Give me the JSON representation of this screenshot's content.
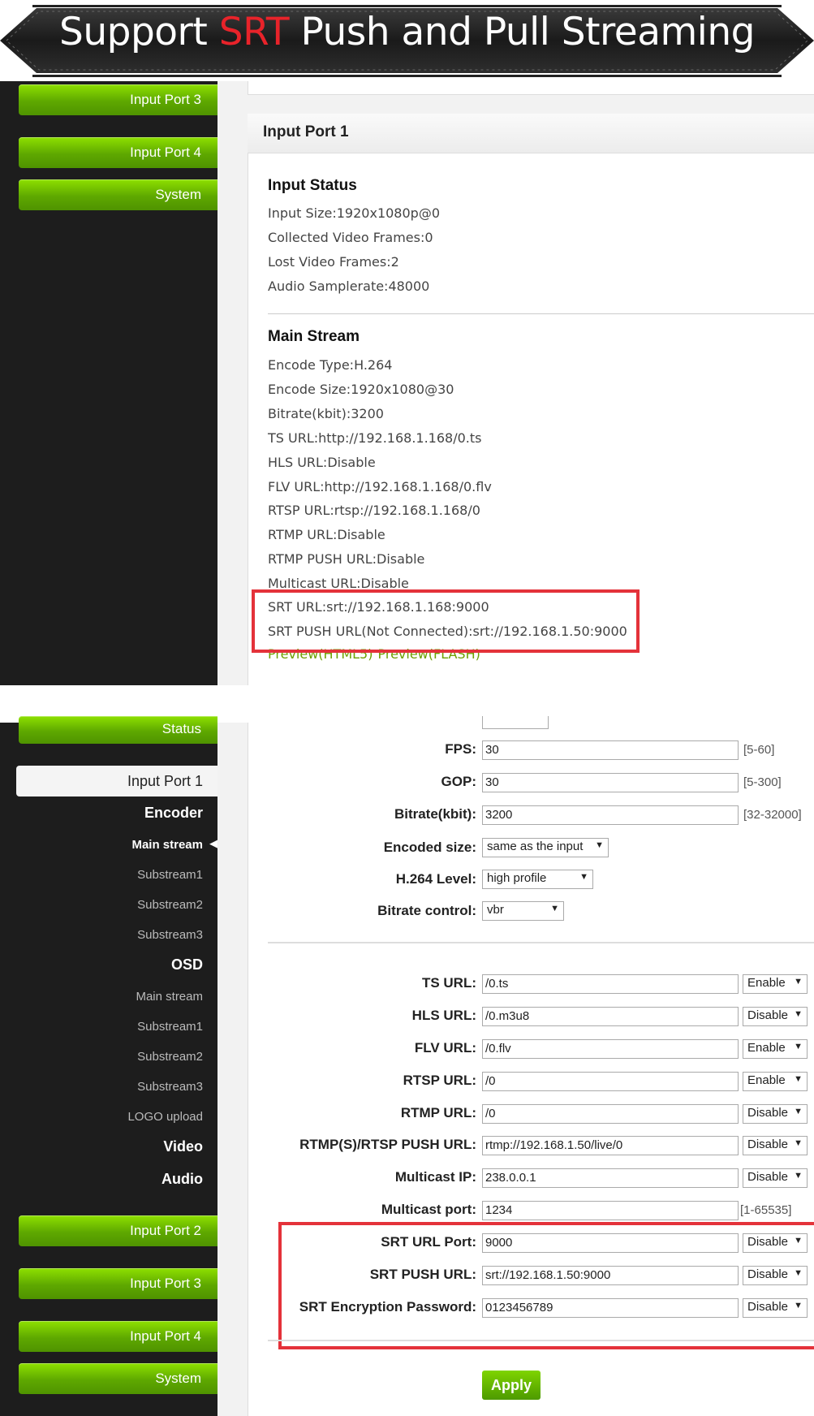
{
  "banner": {
    "title_before": "Support ",
    "title_highlight": "SRT",
    "title_after": " Push and Pull Streaming",
    "highlight_color": "#e8232a"
  },
  "top_sidebar": {
    "items": [
      {
        "label": "Input Port 3"
      },
      {
        "label": "Input Port 4"
      },
      {
        "label": "System"
      }
    ]
  },
  "top_panel": {
    "title": "Input Port 1",
    "input_status": {
      "heading": "Input Status",
      "lines": [
        "Input Size:1920x1080p@0",
        "Collected Video Frames:0",
        "Lost Video Frames:2",
        "Audio Samplerate:48000"
      ]
    },
    "main_stream": {
      "heading": "Main Stream",
      "lines": [
        "Encode Type:H.264",
        "Encode Size:1920x1080@30",
        "Bitrate(kbit):3200",
        "TS URL:http://192.168.1.168/0.ts",
        "HLS URL:Disable",
        "FLV URL:http://192.168.1.168/0.flv",
        "RTSP URL:rtsp://192.168.1.168/0",
        "RTMP URL:Disable",
        "RTMP PUSH URL:Disable",
        "Multicast URL:Disable",
        "SRT URL:srt://192.168.1.168:9000",
        "SRT PUSH URL(Not Connected):srt://192.168.1.50:9000"
      ],
      "preview_html5": "Preview(HTML5)",
      "preview_flash": "Preview(FLASH)"
    }
  },
  "bottom_sidebar": {
    "status_label": "Status",
    "active_item": "Input Port 1",
    "encoder": {
      "label": "Encoder",
      "items": [
        "Main stream",
        "Substream1",
        "Substream2",
        "Substream3"
      ]
    },
    "osd": {
      "label": "OSD",
      "items": [
        "Main stream",
        "Substream1",
        "Substream2",
        "Substream3",
        "LOGO upload"
      ]
    },
    "video_label": "Video",
    "audio_label": "Audio",
    "green_items": [
      {
        "label": "Input Port 2"
      },
      {
        "label": "Input Port 3"
      },
      {
        "label": "Input Port 4"
      },
      {
        "label": "System"
      }
    ]
  },
  "form": {
    "encoding": [
      {
        "label": "FPS:",
        "value": "30",
        "range": "[5-60]"
      },
      {
        "label": "GOP:",
        "value": "30",
        "range": "[5-300]"
      },
      {
        "label": "Bitrate(kbit):",
        "value": "3200",
        "range": "[32-32000]"
      }
    ],
    "selects": [
      {
        "label": "Encoded size:",
        "value": "same as the input"
      },
      {
        "label": "H.264 Level:",
        "value": "high profile"
      },
      {
        "label": "Bitrate control:",
        "value": "vbr"
      }
    ],
    "urls": [
      {
        "label": "TS URL:",
        "value": "/0.ts",
        "state": "Enable"
      },
      {
        "label": "HLS URL:",
        "value": "/0.m3u8",
        "state": "Disable"
      },
      {
        "label": "FLV URL:",
        "value": "/0.flv",
        "state": "Enable"
      },
      {
        "label": "RTSP URL:",
        "value": "/0",
        "state": "Enable"
      },
      {
        "label": "RTMP URL:",
        "value": "/0",
        "state": "Disable"
      },
      {
        "label": "RTMP(S)/RTSP PUSH URL:",
        "value": "rtmp://192.168.1.50/live/0",
        "state": "Disable"
      },
      {
        "label": "Multicast IP:",
        "value": "238.0.0.1",
        "state": "Disable"
      }
    ],
    "multicast_port": {
      "label": "Multicast port:",
      "value": "1234",
      "range": "[1-65535]"
    },
    "srt": [
      {
        "label": "SRT URL Port:",
        "value": "9000",
        "state": "Disable"
      },
      {
        "label": "SRT PUSH URL:",
        "value": "srt://192.168.1.50:9000",
        "state": "Disable"
      },
      {
        "label": "SRT Encryption Password:",
        "value": "0123456789",
        "state": "Disable"
      }
    ],
    "apply_label": "Apply"
  },
  "colors": {
    "sidebar_bg": "#1d1d1d",
    "green_button": "#5ea800",
    "highlight_box": "#e4323a",
    "preview_link": "#6da000"
  },
  "icons": {
    "select_arrow": "▼",
    "active_marker": "◀"
  }
}
